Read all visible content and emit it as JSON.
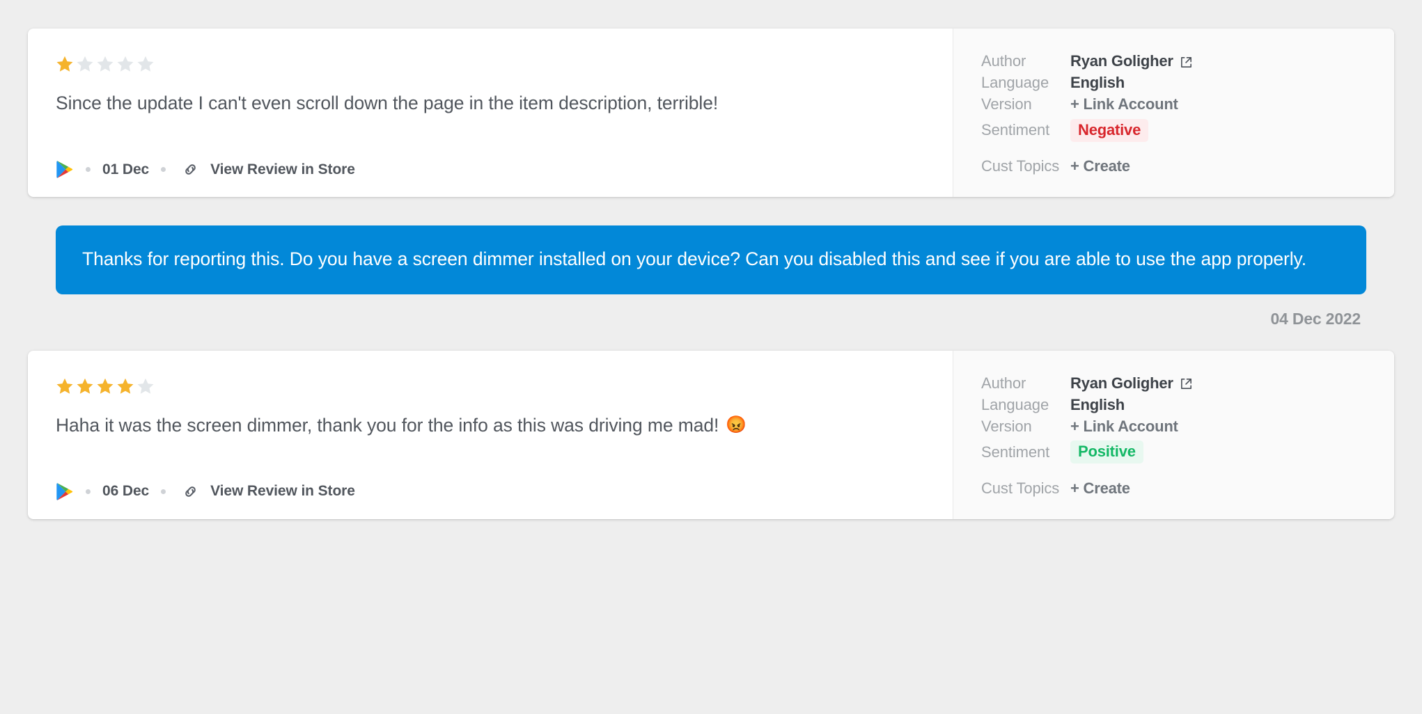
{
  "theme": {
    "page_bg": "#eeeeee",
    "card_bg": "#ffffff",
    "meta_panel_bg": "#fafafa",
    "reply_bubble_bg": "#0288d8",
    "star_filled": "#f5b32c",
    "star_empty": "#e2e6e9",
    "negative_text": "#d8262c",
    "negative_bg": "#fdeced",
    "positive_text": "#14b866",
    "positive_bg": "#e8f8f0"
  },
  "reviews": [
    {
      "rating": 1,
      "max_rating": 5,
      "text": "Since the update I can't even scroll down the page in the item description, terrible!",
      "emoji": "",
      "footer": {
        "store_icon": "google-play-icon",
        "date": "01 Dec",
        "link_icon": "chain-link-icon",
        "link_label": "View Review in Store"
      },
      "meta": {
        "author_label": "Author",
        "author_value": "Ryan Goligher",
        "author_icon": "external-link-icon",
        "language_label": "Language",
        "language_value": "English",
        "version_label": "Version",
        "version_value": "+ Link Account",
        "sentiment_label": "Sentiment",
        "sentiment_value": "Negative",
        "sentiment_type": "negative",
        "cust_topics_label": "Cust Topics",
        "cust_topics_value": "+ Create"
      }
    },
    {
      "rating": 4,
      "max_rating": 5,
      "text": "Haha it was the screen dimmer, thank you for the info as this was driving me mad!",
      "emoji": "😡",
      "footer": {
        "store_icon": "google-play-icon",
        "date": "06 Dec",
        "link_icon": "chain-link-icon",
        "link_label": "View Review in Store"
      },
      "meta": {
        "author_label": "Author",
        "author_value": "Ryan Goligher",
        "author_icon": "external-link-icon",
        "language_label": "Language",
        "language_value": "English",
        "version_label": "Version",
        "version_value": "+ Link Account",
        "sentiment_label": "Sentiment",
        "sentiment_value": "Positive",
        "sentiment_type": "positive",
        "cust_topics_label": "Cust Topics",
        "cust_topics_value": "+ Create"
      }
    }
  ],
  "reply": {
    "text": "Thanks for reporting this. Do you have a screen dimmer installed on your device? Can you disabled this and see if you are able to use the app properly.",
    "date": "04 Dec 2022"
  }
}
